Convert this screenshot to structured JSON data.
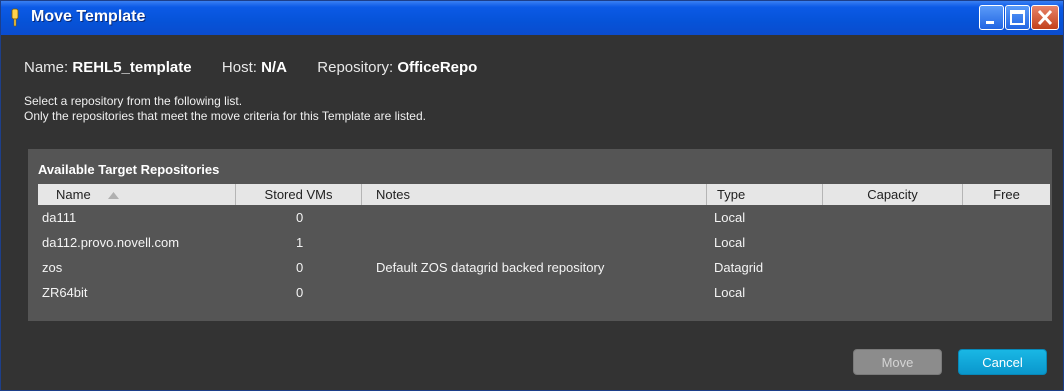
{
  "window": {
    "title": "Move Template",
    "controls": {
      "minimize": "minimize",
      "maximize": "maximize",
      "close": "close"
    }
  },
  "info": {
    "name_label": "Name:",
    "name_value": "REHL5_template",
    "host_label": "Host:",
    "host_value": "N/A",
    "repo_label": "Repository:",
    "repo_value": "OfficeRepo"
  },
  "instructions": [
    "Select a repository from the following list.",
    "Only the repositories that meet the move criteria for this Template are listed."
  ],
  "panel": {
    "title": "Available Target Repositories",
    "columns": [
      "Name",
      "Stored VMs",
      "Notes",
      "Type",
      "Capacity",
      "Free"
    ],
    "sort_column": "Name",
    "sort_direction": "ascending",
    "rows": [
      {
        "name": "da111",
        "stored_vms": "0",
        "notes": "",
        "type": "Local",
        "capacity": "",
        "free": ""
      },
      {
        "name": "da112.provo.novell.com",
        "stored_vms": "1",
        "notes": "",
        "type": "Local",
        "capacity": "",
        "free": ""
      },
      {
        "name": "zos",
        "stored_vms": "0",
        "notes": "Default ZOS datagrid backed repository",
        "type": "Datagrid",
        "capacity": "",
        "free": ""
      },
      {
        "name": "ZR64bit",
        "stored_vms": "0",
        "notes": "",
        "type": "Local",
        "capacity": "",
        "free": ""
      }
    ]
  },
  "buttons": {
    "move": "Move",
    "cancel": "Cancel",
    "move_enabled": false
  },
  "colors": {
    "titlebar": "#0653d8",
    "panel": "#555555",
    "background": "#333333",
    "cancel": "#12a8dc"
  }
}
